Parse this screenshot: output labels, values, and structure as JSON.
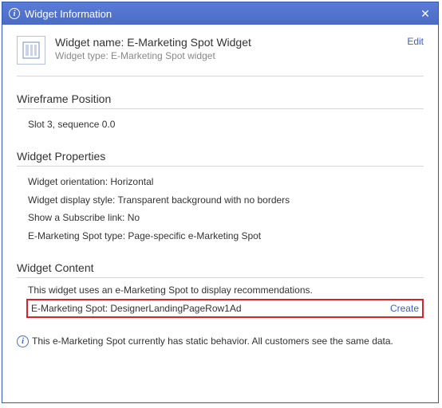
{
  "dialog": {
    "title": "Widget Information"
  },
  "header": {
    "name_label": "Widget name:",
    "name_value": "E-Marketing Spot Widget",
    "type_label": "Widget type:",
    "type_value": "E-Marketing Spot widget",
    "edit": "Edit"
  },
  "sections": {
    "wireframe": {
      "title": "Wireframe Position",
      "slot": "Slot 3, sequence 0.0"
    },
    "properties": {
      "title": "Widget Properties",
      "lines": [
        "Widget orientation: Horizontal",
        "Widget display style: Transparent background with no borders",
        "Show a Subscribe link: No",
        "E-Marketing Spot type: Page-specific e-Marketing Spot"
      ]
    },
    "content": {
      "title": "Widget Content",
      "desc": "This widget uses an e-Marketing Spot to display recommendations.",
      "spot_label": "E-Marketing Spot:",
      "spot_value": "DesignerLandingPageRow1Ad",
      "create": "Create"
    }
  },
  "footer": {
    "note": "This e-Marketing Spot currently has static behavior. All customers see the same data."
  }
}
